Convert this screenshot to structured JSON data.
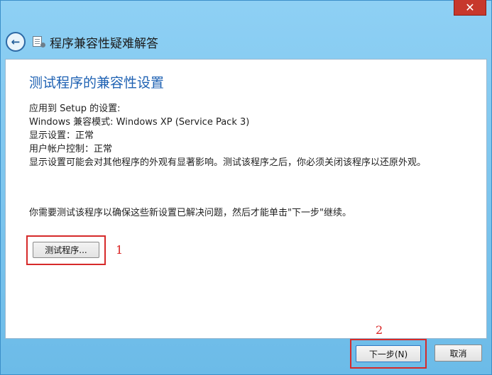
{
  "window": {
    "title": "程序兼容性疑难解答",
    "close_label": "✕"
  },
  "header": {
    "back_icon": "back-arrow-icon",
    "app_icon": "compat-troubleshooter-icon"
  },
  "content": {
    "heading": "测试程序的兼容性设置",
    "lines": [
      "应用到  Setup 的设置:",
      "Windows 兼容模式: Windows XP (Service Pack 3)",
      "显示设置：正常",
      "用户帐户控制：正常",
      "显示设置可能会对其他程序的外观有显著影响。测试该程序之后，你必须关闭该程序以还原外观。"
    ],
    "instruction": "你需要测试该程序以确保这些新设置已解决问题，然后才能单击\"下一步\"继续。",
    "test_button": "测试程序..."
  },
  "footer": {
    "next_button": "下一步(N)",
    "cancel_button": "取消"
  },
  "annotations": {
    "one": "1",
    "two": "2"
  },
  "colors": {
    "frame": "#79c4ee",
    "heading": "#1f62b3",
    "highlight": "#d62a2a",
    "close": "#c7382c"
  }
}
